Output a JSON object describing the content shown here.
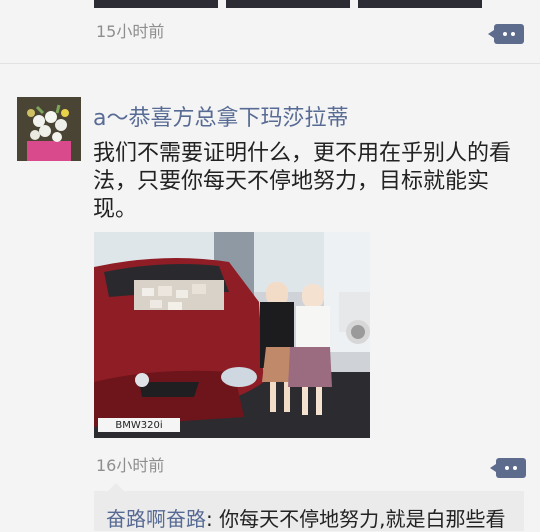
{
  "prev_post": {
    "time": "15小时前"
  },
  "post": {
    "username": "a～恭喜方总拿下玛莎拉蒂",
    "text": "我们不需要证明什么，更不用在乎别人的看法，只要你每天不停地努力，目标就能实现。",
    "photo_plate": "BMW320i",
    "time": "16小时前"
  },
  "comment": {
    "author": "奋路啊奋路",
    "text": ": 你每天不停地努力,就是白那些看"
  },
  "colors": {
    "link": "#586b94",
    "more_button": "#5d6b8c",
    "background": "#f4f4f4"
  },
  "icons": {
    "more": "more-dots-icon"
  }
}
